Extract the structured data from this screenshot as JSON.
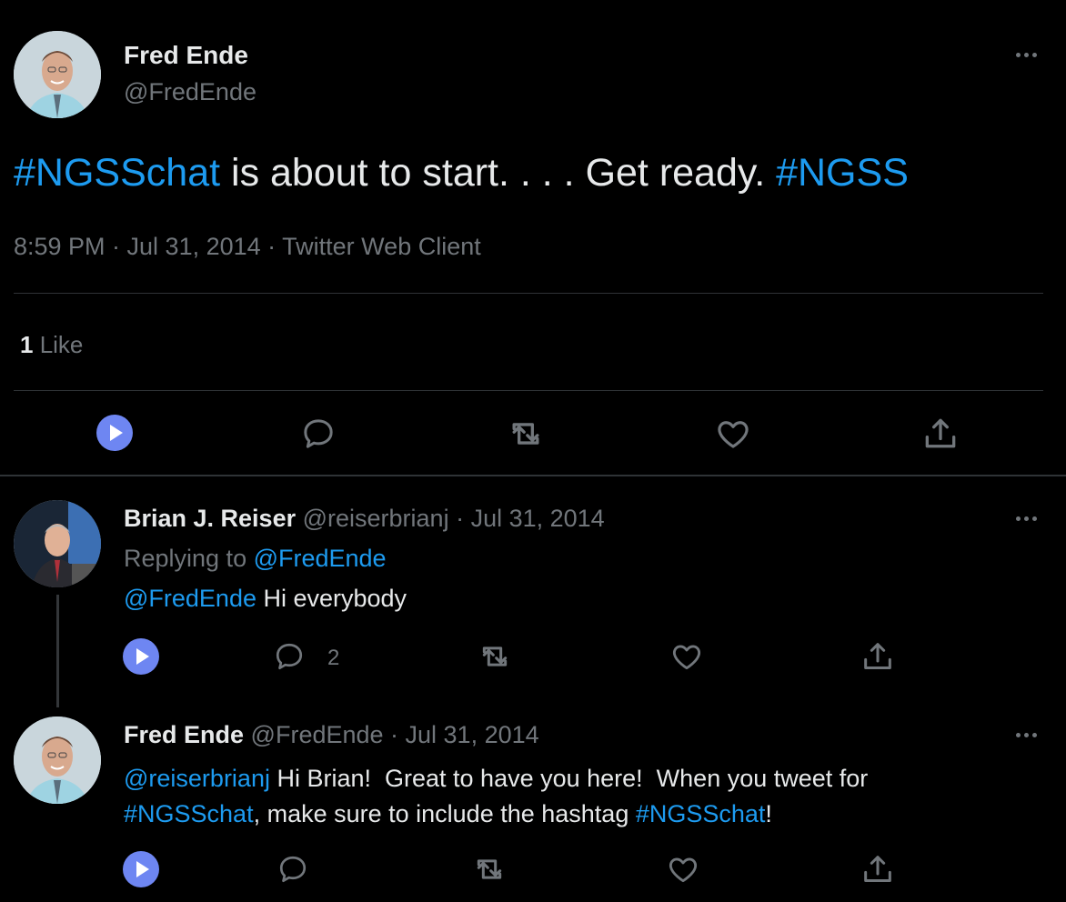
{
  "main_tweet": {
    "author_name": "Fred Ende",
    "author_handle": "@FredEnde",
    "text_parts": {
      "hashtag1": "#NGSSchat",
      "text": " is about to start. . . . Get ready. ",
      "hashtag2": "#NGSS"
    },
    "meta": "8:59 PM · Jul 31, 2014 · Twitter Web Client",
    "likes_count": "1",
    "likes_label": " Like"
  },
  "replies": [
    {
      "author_name": "Brian J. Reiser",
      "author_handle": "@reiserbrianj",
      "date": " · Jul 31, 2014",
      "replying_to_label": "Replying to ",
      "replying_to_handle": "@FredEnde",
      "mention": "@FredEnde",
      "text": " Hi everybody",
      "reply_count": "2"
    },
    {
      "author_name": "Fred Ende",
      "author_handle": "@FredEnde",
      "date": " · Jul 31, 2014",
      "mention": "@reiserbrianj",
      "text_line1": " Hi Brian!  Great to have you here!  When you tweet for",
      "hashtag1": "#NGSSchat",
      "text_line2": ", make sure to include the hashtag ",
      "hashtag2": "#NGSSchat",
      "text_end": "!"
    }
  ],
  "colors": {
    "background": "#000000",
    "link": "#1d9bf0",
    "muted": "#71767b",
    "play_button": "#6e86f2"
  }
}
